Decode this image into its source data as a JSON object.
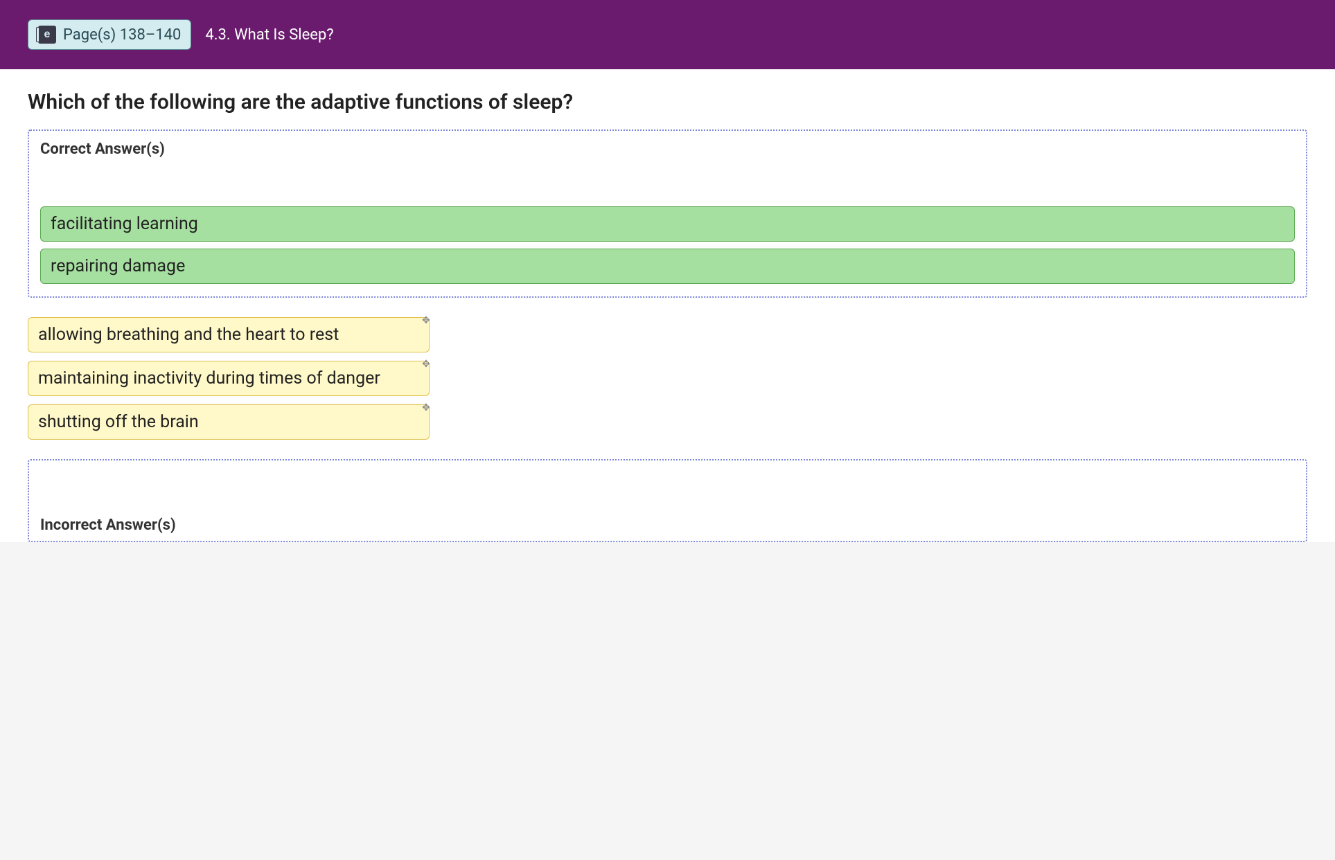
{
  "header": {
    "page_label": "Page(s) 138–140",
    "section_title": "4.3. What Is Sleep?",
    "ebook_icon_letter": "e"
  },
  "question": {
    "prompt": "Which of the following are the adaptive functions of sleep?",
    "correct_zone_label": "Correct Answer(s)",
    "incorrect_zone_label": "Incorrect Answer(s)",
    "correct_answers": [
      "facilitating learning",
      "repairing damage"
    ],
    "unplaced_answers": [
      "allowing breathing and the heart to rest",
      "maintaining inactivity during times of danger",
      "shutting off the brain"
    ]
  }
}
